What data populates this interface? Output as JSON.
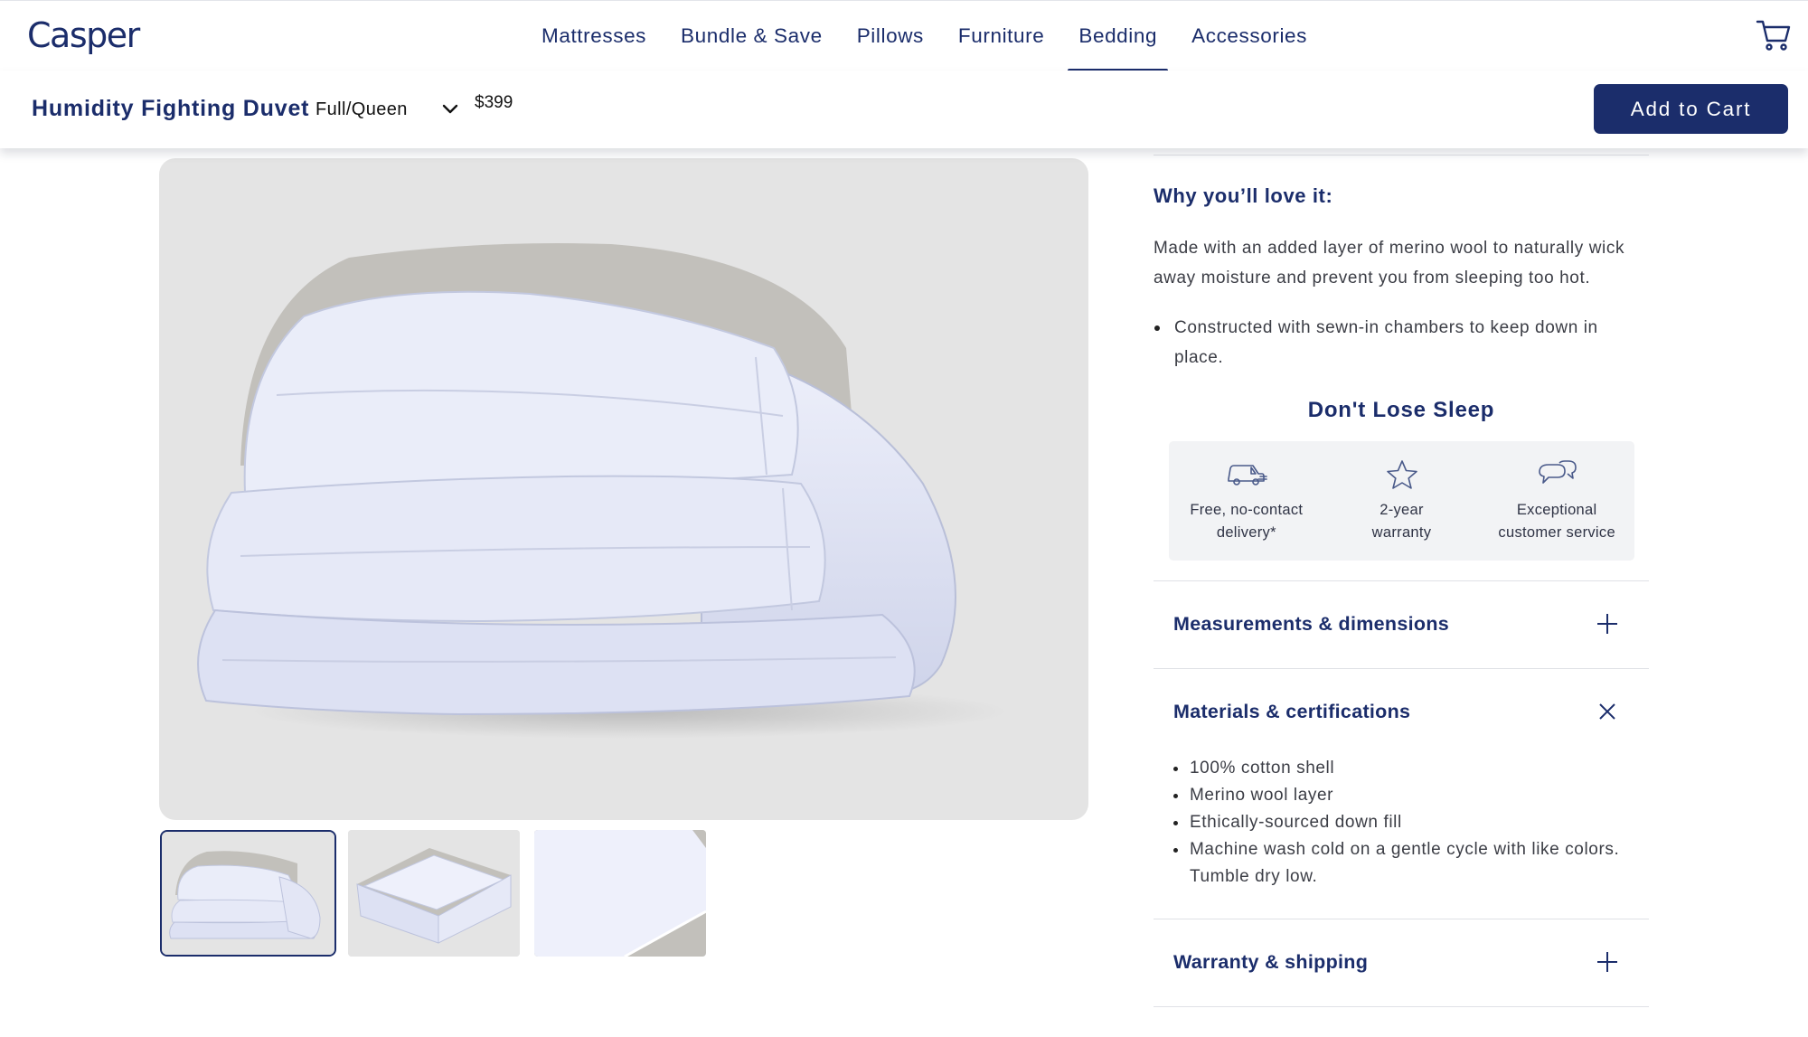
{
  "nav": {
    "logo": "Casper",
    "links": [
      "Mattresses",
      "Bundle & Save",
      "Pillows",
      "Furniture",
      "Bedding",
      "Accessories"
    ],
    "active": "Bedding",
    "cart_icon": "cart-icon"
  },
  "product_bar": {
    "name": "Humidity Fighting Duvet",
    "size": "Full/Queen",
    "price": "$399",
    "add_to_cart": "Add to Cart"
  },
  "gallery": {
    "thumbnail_count": 3,
    "selected_index": 0
  },
  "details": {
    "why_heading": "Why you’ll love it:",
    "description": "Made with an added layer of merino wool to naturally wick away moisture and prevent you from sleeping too hot.",
    "bullet": "Constructed with sewn-in chambers to keep down in place.",
    "dont_lose_sleep": "Don't Lose Sleep",
    "perks": [
      {
        "icon": "truck-icon",
        "line1": "Free, no-contact",
        "line2": "delivery*"
      },
      {
        "icon": "star-icon",
        "line1": "2-year",
        "line2": "warranty"
      },
      {
        "icon": "chat-bubbles-icon",
        "line1": "Exceptional",
        "line2": "customer service"
      }
    ]
  },
  "accordions": {
    "measurements": {
      "title": "Measurements & dimensions",
      "state": "collapsed"
    },
    "materials": {
      "title": "Materials & certifications",
      "state": "expanded",
      "items": [
        "100% cotton shell",
        "Merino wool layer",
        "Ethically-sourced down fill",
        "Machine wash cold on a gentle cycle with like colors. Tumble dry low."
      ]
    },
    "warranty": {
      "title": "Warranty & shipping",
      "state": "collapsed"
    }
  },
  "colors": {
    "brand_navy": "#1b2d6b",
    "image_bg": "#e4e4e4",
    "perk_bg": "#f2f3f5"
  }
}
